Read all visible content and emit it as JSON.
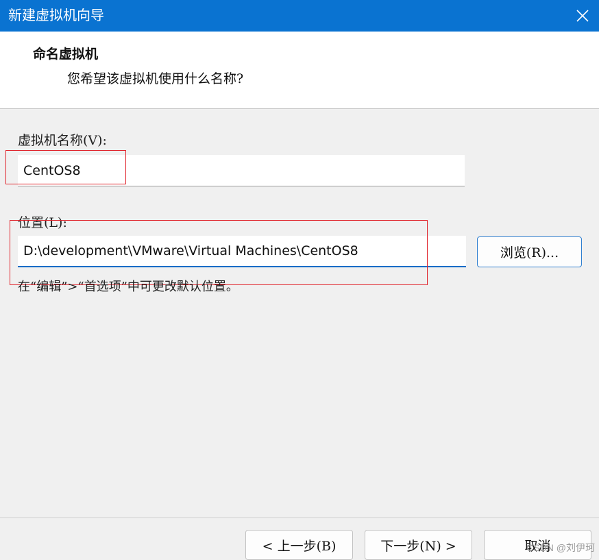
{
  "window": {
    "title": "新建虚拟机向导",
    "close_icon": "close-icon"
  },
  "header": {
    "heading": "命名虚拟机",
    "subheading": "您希望该虚拟机使用什么名称?"
  },
  "form": {
    "name_label": "虚拟机名称(V):",
    "name_value": "CentOS8",
    "location_label": "位置(L):",
    "location_value": "D:\\development\\VMware\\Virtual Machines\\CentOS8",
    "browse_label": "浏览(R)...",
    "hint": "在“编辑”>“首选项”中可更改默认位置。"
  },
  "buttons": {
    "back": "< 上一步(B)",
    "next": "下一步(N) >",
    "cancel": "取消"
  },
  "watermark": "CSDN @刘伊珂",
  "colors": {
    "titlebar": "#0a73d1",
    "annotation_red": "#e0242c",
    "focus_blue": "#0a6cc7"
  }
}
